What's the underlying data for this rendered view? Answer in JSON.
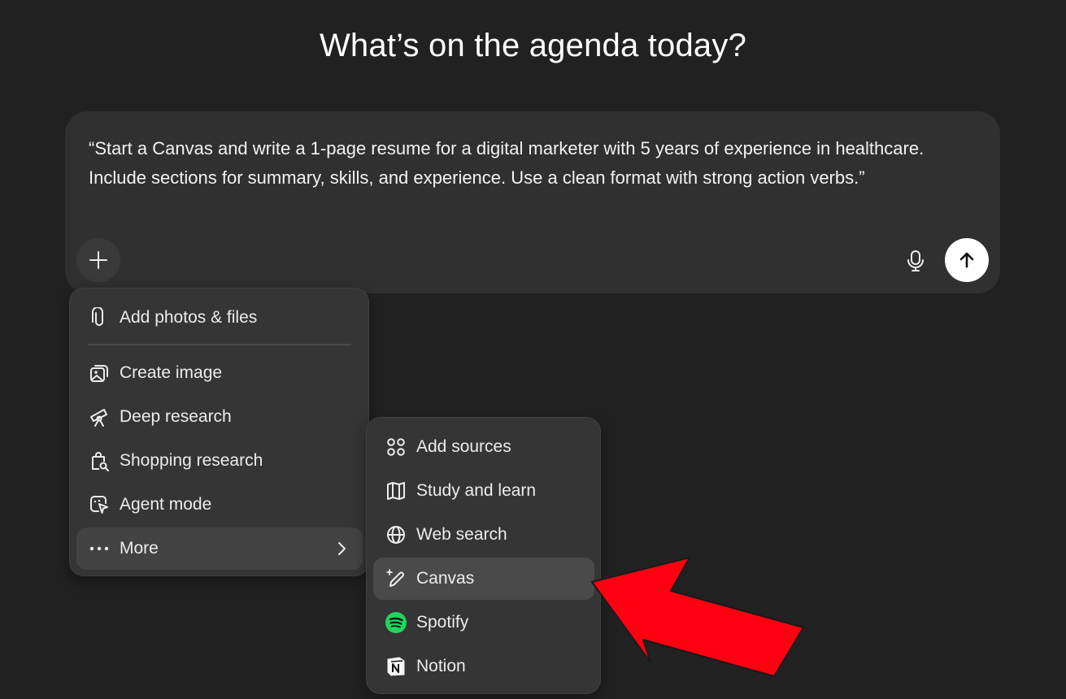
{
  "heading": "What’s on the agenda today?",
  "composer": {
    "prompt": "“Start a Canvas and write a 1-page resume for a digital marketer with 5 years of experience in healthcare. Include sections for summary, skills, and experience. Use a clean format with strong action verbs.”"
  },
  "menu": {
    "items": [
      {
        "label": "Add photos & files",
        "icon": "paperclip-icon"
      },
      {
        "label": "Create image",
        "icon": "image-icon"
      },
      {
        "label": "Deep research",
        "icon": "telescope-icon"
      },
      {
        "label": "Shopping research",
        "icon": "shopping-bag-icon"
      },
      {
        "label": "Agent mode",
        "icon": "agent-cursor-icon"
      },
      {
        "label": "More",
        "icon": "ellipsis-icon"
      }
    ]
  },
  "submenu": {
    "items": [
      {
        "label": "Add sources",
        "icon": "sources-icon"
      },
      {
        "label": "Study and learn",
        "icon": "book-icon"
      },
      {
        "label": "Web search",
        "icon": "globe-icon"
      },
      {
        "label": "Canvas",
        "icon": "pencil-sparkle-icon"
      },
      {
        "label": "Spotify",
        "icon": "spotify-icon"
      },
      {
        "label": "Notion",
        "icon": "notion-icon"
      }
    ]
  },
  "colors": {
    "background": "#212121",
    "composer": "#303030",
    "menu": "#353535",
    "highlight": "#4a4a4a",
    "annotation_arrow": "#ff0010",
    "spotify": "#1ed760"
  }
}
